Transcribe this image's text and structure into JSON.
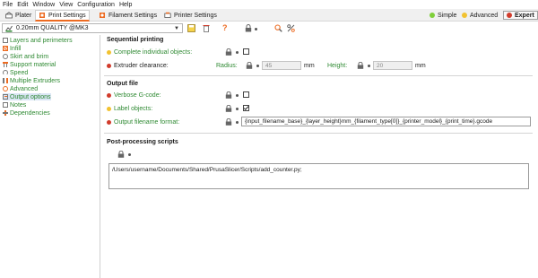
{
  "menu": [
    "File",
    "Edit",
    "Window",
    "View",
    "Configuration",
    "Help"
  ],
  "tabs": [
    {
      "label": "Plater",
      "icon": "plater-icon"
    },
    {
      "label": "Print Settings",
      "icon": "print-settings-icon"
    },
    {
      "label": "Filament Settings",
      "icon": "filament-icon"
    },
    {
      "label": "Printer Settings",
      "icon": "printer-icon"
    }
  ],
  "modes": [
    {
      "label": "Simple",
      "color": "#7fcf3a"
    },
    {
      "label": "Advanced",
      "color": "#f2c230"
    },
    {
      "label": "Expert",
      "color": "#d13b2b"
    }
  ],
  "preset": {
    "name": "0.20mm QUALITY @MK3",
    "icon": "print-preset-icon"
  },
  "sidebar": {
    "items": [
      {
        "label": "Layers and perimeters",
        "icon": "layers-icon"
      },
      {
        "label": "Infill",
        "icon": "infill-icon"
      },
      {
        "label": "Skirt and brim",
        "icon": "skirt-icon"
      },
      {
        "label": "Support material",
        "icon": "support-icon"
      },
      {
        "label": "Speed",
        "icon": "speed-icon"
      },
      {
        "label": "Multiple Extruders",
        "icon": "extruders-icon"
      },
      {
        "label": "Advanced",
        "icon": "advanced-icon"
      },
      {
        "label": "Output options",
        "icon": "output-icon"
      },
      {
        "label": "Notes",
        "icon": "notes-icon"
      },
      {
        "label": "Dependencies",
        "icon": "dependencies-icon"
      }
    ]
  },
  "sections": {
    "sequential": {
      "title": "Sequential printing",
      "complete_objects": "Complete individual objects:",
      "extruder_clearance": "Extruder clearance:",
      "radius_label": "Radius:",
      "radius_value": "45",
      "radius_unit": "mm",
      "height_label": "Height:",
      "height_value": "20",
      "height_unit": "mm"
    },
    "output_file": {
      "title": "Output file",
      "verbose": "Verbose G-code:",
      "label_objects": "Label objects:",
      "format_label": "Output filename format:",
      "format_value": "{input_filename_base}_{layer_height}mm_{filament_type[0]}_{printer_model}_{print_time}.gcode"
    },
    "post": {
      "title": "Post-processing scripts",
      "script": "/Users/username/Documents/Shared/PrusaSlicer/Scripts/add_counter.py;"
    }
  },
  "colors": {
    "accent": "#ed6b21",
    "label_green": "#2f8a33",
    "simple": "#7fcf3a",
    "advanced": "#f2c230",
    "expert": "#d13b2b"
  }
}
